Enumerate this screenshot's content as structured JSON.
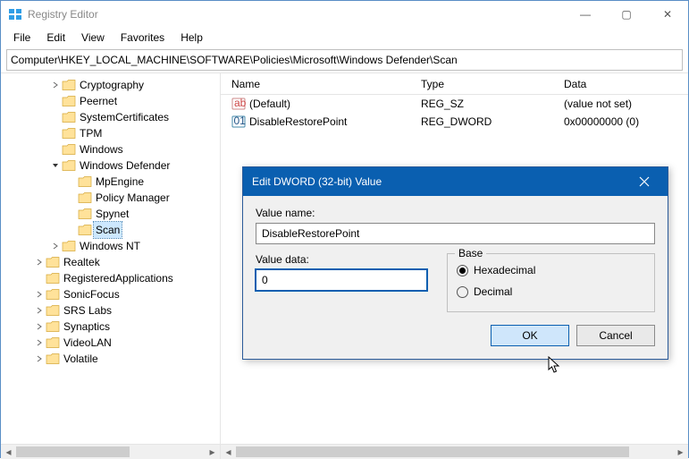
{
  "window": {
    "title": "Registry Editor",
    "controls": {
      "min": "—",
      "max": "▢",
      "close": "✕"
    }
  },
  "menu": {
    "items": [
      "File",
      "Edit",
      "View",
      "Favorites",
      "Help"
    ]
  },
  "address": "Computer\\HKEY_LOCAL_MACHINE\\SOFTWARE\\Policies\\Microsoft\\Windows Defender\\Scan",
  "tree": [
    {
      "indent": 3,
      "chev": ">",
      "label": "Cryptography"
    },
    {
      "indent": 3,
      "chev": "",
      "label": "Peernet"
    },
    {
      "indent": 3,
      "chev": "",
      "label": "SystemCertificates"
    },
    {
      "indent": 3,
      "chev": "",
      "label": "TPM"
    },
    {
      "indent": 3,
      "chev": "",
      "label": "Windows"
    },
    {
      "indent": 3,
      "chev": "v",
      "label": "Windows Defender"
    },
    {
      "indent": 4,
      "chev": "",
      "label": "MpEngine"
    },
    {
      "indent": 4,
      "chev": "",
      "label": "Policy Manager"
    },
    {
      "indent": 4,
      "chev": "",
      "label": "Spynet"
    },
    {
      "indent": 4,
      "chev": "",
      "label": "Scan",
      "selected": true
    },
    {
      "indent": 3,
      "chev": ">",
      "label": "Windows NT"
    },
    {
      "indent": 2,
      "chev": ">",
      "label": "Realtek"
    },
    {
      "indent": 2,
      "chev": "",
      "label": "RegisteredApplications"
    },
    {
      "indent": 2,
      "chev": ">",
      "label": "SonicFocus"
    },
    {
      "indent": 2,
      "chev": ">",
      "label": "SRS Labs"
    },
    {
      "indent": 2,
      "chev": ">",
      "label": "Synaptics"
    },
    {
      "indent": 2,
      "chev": ">",
      "label": "VideoLAN"
    },
    {
      "indent": 2,
      "chev": ">",
      "label": "Volatile"
    }
  ],
  "list": {
    "headers": {
      "name": "Name",
      "type": "Type",
      "data": "Data"
    },
    "rows": [
      {
        "icon": "reg-sz",
        "name": "(Default)",
        "type": "REG_SZ",
        "data": "(value not set)"
      },
      {
        "icon": "reg-dw",
        "name": "DisableRestorePoint",
        "type": "REG_DWORD",
        "data": "0x00000000 (0)"
      }
    ]
  },
  "dialog": {
    "title": "Edit DWORD (32-bit) Value",
    "value_name_label": "Value name:",
    "value_name": "DisableRestorePoint",
    "value_data_label": "Value data:",
    "value_data": "0",
    "base_label": "Base",
    "radio_hex": "Hexadecimal",
    "radio_dec": "Decimal",
    "ok": "OK",
    "cancel": "Cancel"
  }
}
